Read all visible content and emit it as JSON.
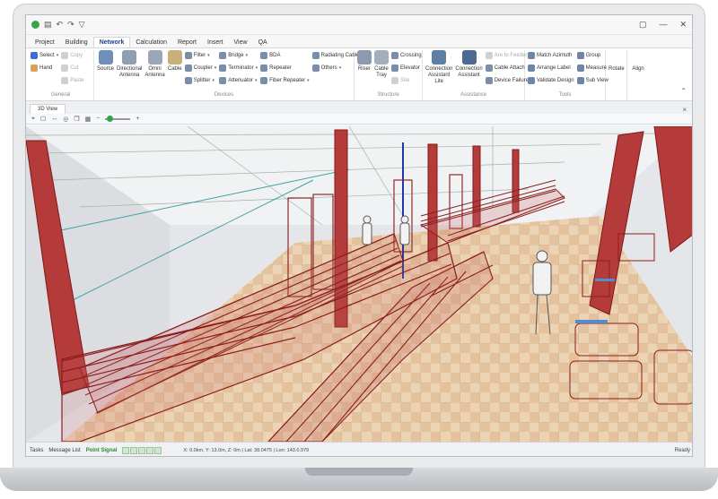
{
  "window": {
    "quick_access": [
      "▤",
      "↶",
      "↷",
      "▽"
    ],
    "controls": [
      "▢",
      "—",
      "✕"
    ]
  },
  "menu": {
    "tabs": [
      "Project",
      "Building",
      "Network",
      "Calculation",
      "Report",
      "Insert",
      "View",
      "QA"
    ],
    "active": "Network"
  },
  "ribbon": {
    "general": {
      "label": "General",
      "select": "Select",
      "hand": "Hand",
      "copy": "Copy",
      "cut": "Cut",
      "paste": "Paste"
    },
    "devices": {
      "label": "Devices",
      "source": "Source",
      "directional": "Directional Antenna",
      "omni": "Omni Antenna",
      "cable": "Cable",
      "filter": "Filter",
      "coupler": "Coupler",
      "splitter": "Splitter",
      "bridge": "Bridge",
      "terminator": "Terminator",
      "attenuator": "Attenuator",
      "bda": "BDA",
      "repeater": "Repeater",
      "fiber_repeater": "Fiber Repeater",
      "radiating_cable": "Radiating Cable",
      "others": "Others"
    },
    "structure": {
      "label": "Structure",
      "riser": "Riser",
      "cable_tray": "Cable Tray",
      "crossing": "Crossing",
      "elevator": "Elevator",
      "site": "Site"
    },
    "assistance": {
      "label": "Assistance",
      "conn_lite": "Connection Assistant Lite",
      "conn": "Connection Assistant",
      "are_to_feeder": "Are to Feeder",
      "cable_attach": "Cable Attach",
      "device_failure": "Device Failure"
    },
    "tools": {
      "label": "Tools",
      "match_azimuth": "Match Azimuth",
      "arrange_label": "Arrange Label",
      "validate_design": "Validate Design",
      "group": "Group",
      "measure": "Measure",
      "sub_view": "Sub View",
      "rotate": "Rotate",
      "align": "Align"
    }
  },
  "document": {
    "tab": "3D View",
    "close": "×"
  },
  "viewtools": [
    "⌖",
    "☐",
    "↔",
    "◎",
    "❒",
    "▦",
    "−",
    "+"
  ],
  "statusbar": {
    "tabs": [
      "Tasks",
      "Message List",
      "Point Signal"
    ],
    "active": "Point Signal",
    "coords": "X: 0.0km, Y: 13.0m, Z: 0m | Lat: 38.0475 | Lon: 143.0.979",
    "ready": "Ready"
  },
  "colors": {
    "accent": "#1f3f8f",
    "status_active": "#2a8a3a",
    "railing": "#8b1d1d",
    "column": "#9b2b2b",
    "floor": "#e6c7a3"
  }
}
